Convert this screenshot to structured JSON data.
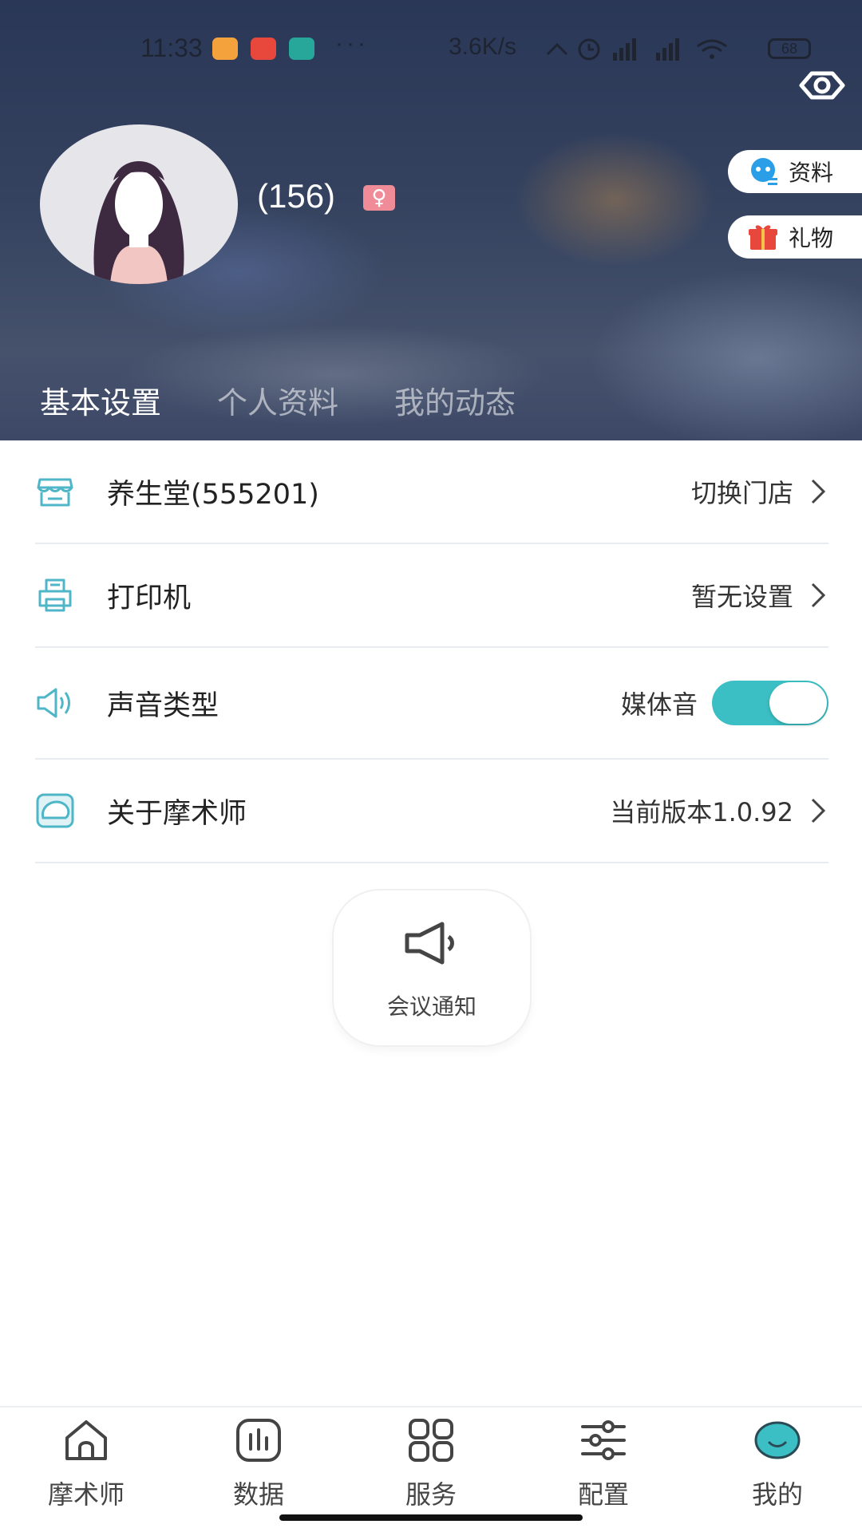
{
  "status_bar": {
    "time": "11:33",
    "dots": "···",
    "net_speed": "3.6K/s",
    "battery": "68"
  },
  "header": {
    "user_count": "(156)",
    "gender_symbol": "♀",
    "side_buttons": [
      {
        "label": "资料",
        "icon": "profile-robot-icon"
      },
      {
        "label": "礼物",
        "icon": "gift-icon"
      }
    ],
    "tabs": [
      {
        "label": "基本设置",
        "active": true
      },
      {
        "label": "个人资料",
        "active": false
      },
      {
        "label": "我的动态",
        "active": false
      }
    ]
  },
  "settings": {
    "store": {
      "label": "养生堂(555201)",
      "value": "切换门店",
      "icon": "store-icon"
    },
    "printer": {
      "label": "打印机",
      "value": "暂无设置",
      "icon": "printer-icon"
    },
    "sound": {
      "label": "声音类型",
      "value": "媒体音",
      "icon": "speaker-icon",
      "toggle_on": true
    },
    "about": {
      "label": "关于摩术师",
      "value": "当前版本1.0.92",
      "icon": "app-logo-icon"
    }
  },
  "meeting": {
    "label": "会议通知",
    "icon": "megaphone-icon"
  },
  "bottom_nav": [
    {
      "label": "摩术师",
      "icon": "home-icon"
    },
    {
      "label": "数据",
      "icon": "data-chart-icon"
    },
    {
      "label": "服务",
      "icon": "grid-icon"
    },
    {
      "label": "配置",
      "icon": "sliders-icon"
    },
    {
      "label": "我的",
      "icon": "smile-face-icon",
      "active": true
    }
  ],
  "colors": {
    "accent": "#3bbfc4",
    "header_bg": "#34425f",
    "gender_badge": "#f08c98",
    "icon_teal": "#4fb6c8"
  }
}
